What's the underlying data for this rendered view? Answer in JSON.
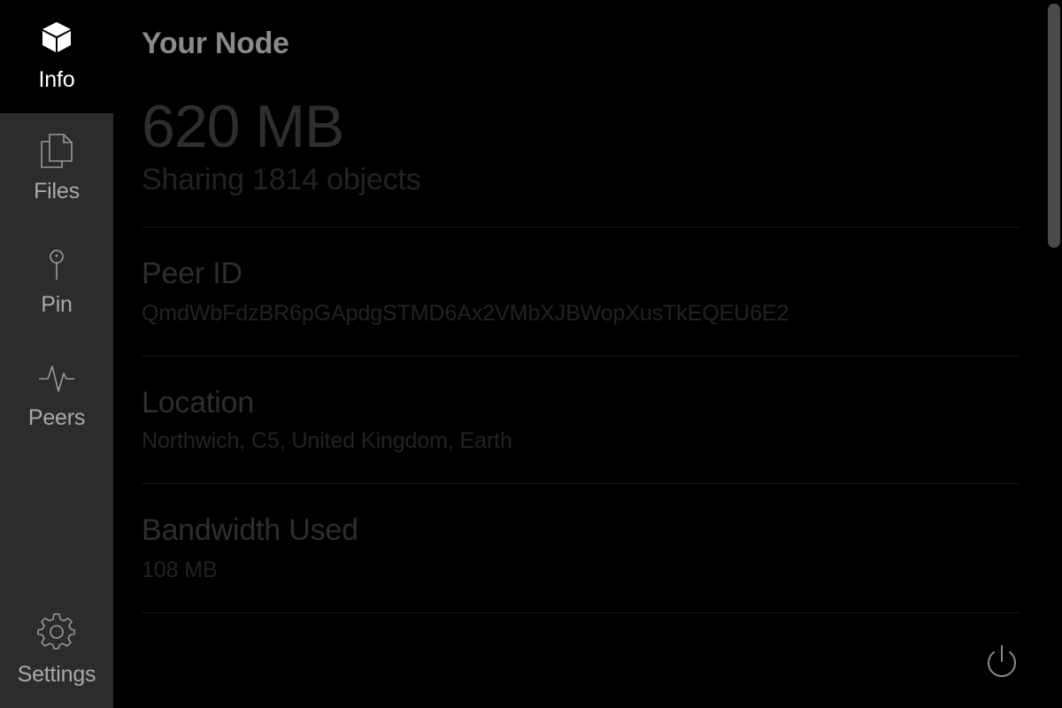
{
  "sidebar": {
    "items": [
      {
        "label": "Info",
        "icon": "cube-icon",
        "active": true
      },
      {
        "label": "Files",
        "icon": "files-icon",
        "active": false
      },
      {
        "label": "Pin",
        "icon": "pin-icon",
        "active": false
      },
      {
        "label": "Peers",
        "icon": "pulse-icon",
        "active": false
      }
    ],
    "settings": {
      "label": "Settings",
      "icon": "gear-icon"
    }
  },
  "main": {
    "title": "Your Node",
    "storage": {
      "size": "620 MB",
      "subtitle": "Sharing 1814 objects"
    },
    "sections": [
      {
        "title": "Peer ID",
        "value": "QmdWbFdzBR6pGApdgSTMD6Ax2VMbXJBWopXusTkEQEU6E2"
      },
      {
        "title": "Location",
        "value": "Northwich, C5, United Kingdom, Earth"
      },
      {
        "title": "Bandwidth Used",
        "value": "108 MB"
      }
    ],
    "power_icon": "power-icon"
  },
  "colors": {
    "sidebar_bg": "#2c2c2c",
    "active_bg": "#000000",
    "main_bg": "#000000",
    "active_label": "#ffffff",
    "inactive_label": "#a9a9a9"
  }
}
